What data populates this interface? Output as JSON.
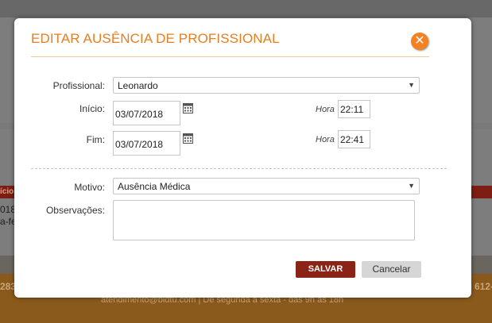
{
  "background": {
    "red_bar_text": "ício",
    "row_text_1": "018",
    "row_text_2": "a-fe",
    "footer_left": "283",
    "footer_right": "612-",
    "footer_center": "atendimento@bldtu.com  |  De segunda a sexta - das 9h às 18h"
  },
  "modal": {
    "title": "EDITAR AUSÊNCIA DE PROFISSIONAL",
    "close_symbol": "✕",
    "form": {
      "profissional_label": "Profissional:",
      "profissional_value": "Leonardo",
      "inicio_label": "Início:",
      "inicio_date": "03/07/2018",
      "inicio_hora_label": "Hora",
      "inicio_time": "22:11",
      "fim_label": "Fim:",
      "fim_date": "03/07/2018",
      "fim_hora_label": "Hora",
      "fim_time": "22:41",
      "motivo_label": "Motivo:",
      "motivo_value": "Ausência Médica",
      "observacoes_label": "Observações:",
      "observacoes_value": ""
    },
    "buttons": {
      "save_label": "SALVAR",
      "cancel_label": "Cancelar"
    }
  },
  "colors": {
    "title_orange": "#e67e22",
    "close_orange": "#f58220",
    "save_red": "#8b2416",
    "cancel_gray": "#d6d6d6"
  },
  "icons": [
    "close-icon",
    "calendar-icon",
    "dropdown-arrow-icon"
  ]
}
